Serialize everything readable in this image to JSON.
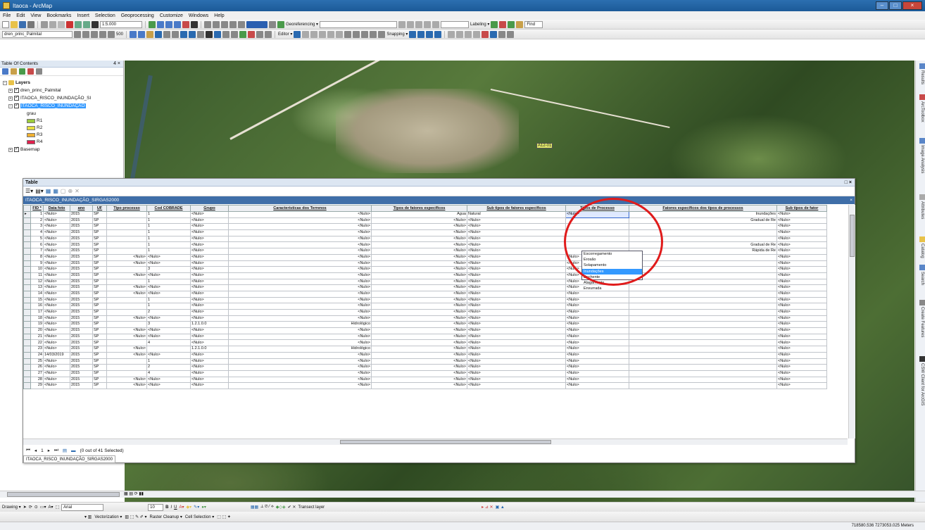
{
  "window": {
    "title": "Itaoca - ArcMap"
  },
  "menu": [
    "File",
    "Edit",
    "View",
    "Bookmarks",
    "Insert",
    "Selection",
    "Geoprocessing",
    "Customize",
    "Windows",
    "Help"
  ],
  "toolbar1": {
    "scale": "1:5.000",
    "georef_label": "Georeferencing ▾",
    "labeling_label": "Labeling ▾",
    "find_label": "Find"
  },
  "toolbar2": {
    "layer_combo": "dren_princ_Palmital",
    "value_500": "500",
    "editor_label": "Editor ▾",
    "snapping_label": "Snapping ▾"
  },
  "toc": {
    "header": "Table Of Contents",
    "pin": "4 ×",
    "layers_label": "Layers",
    "layer1": "dren_princ_Palmital",
    "layer2": "ITAOCA_RISCO_INUNDAÇÃO_SI",
    "layer3": "ITAOCA_RISCO_INUNDAÇÃO",
    "field": "grau",
    "classes": [
      {
        "label": "R1",
        "color": "#9ccc3c"
      },
      {
        "label": "R2",
        "color": "#e8e040"
      },
      {
        "label": "R3",
        "color": "#f0b030"
      },
      {
        "label": "R4",
        "color": "#e0204c"
      }
    ],
    "basemap": "Basemap"
  },
  "map": {
    "label": "A12-01"
  },
  "table_window": {
    "title": "Table",
    "close": "□ ×",
    "tab_name": "ITAOCA_RISCO_INUNDAÇÃO_SIRGAS2000",
    "tab_close": "×",
    "columns": [
      "FID *",
      "Data foto",
      "ano",
      "UF",
      "Tipo processo",
      "Cod COBRADE",
      "Grupo",
      "Características dos Terrenos",
      "Tipos de fatores específicos",
      "Sub tipos de fatores específicos",
      "Tipos de Processo",
      "Fatores específicos dos tipos de processos",
      "Sub tipos de fator"
    ],
    "status_nav": "1",
    "status_text": "(0 out of 41 Selected)",
    "bottom_tab": "ITAOCA_RISCO_INUNDAÇÃO_SIRGAS2000"
  },
  "rows": [
    [
      "1",
      "<Nulo>",
      "2015",
      "SP",
      "",
      "1",
      "<Nulo>",
      "<Nulo>",
      "Água",
      "Natural",
      "<Nulo>",
      "Inundações",
      "<Nulo>",
      ""
    ],
    [
      "2",
      "<Nulo>",
      "2015",
      "SP",
      "",
      "1",
      "<Nulo>",
      "<Nulo>",
      "<Nulo>",
      "",
      "<Nulo>",
      "",
      "",
      "Gradual de Re",
      "<Nulo>"
    ],
    [
      "3",
      "<Nulo>",
      "2015",
      "SP",
      "",
      "1",
      "<Nulo>",
      "<Nulo>",
      "<Nulo>",
      "",
      "<Nulo>",
      "",
      "<Nulo>",
      "",
      "<Nulo>"
    ],
    [
      "4",
      "<Nulo>",
      "2015",
      "SP",
      "",
      "1",
      "<Nulo>",
      "<Nulo>",
      "<Nulo>",
      "",
      "<Nulo>",
      "",
      "<Nulo>",
      "",
      "<Nulo>"
    ],
    [
      "5",
      "<Nulo>",
      "2015",
      "SP",
      "",
      "1",
      "<Nulo>",
      "<Nulo>",
      "<Nulo>",
      "",
      "<Nulo>",
      "",
      "<Nulo>",
      "",
      "<Nulo>"
    ],
    [
      "6",
      "<Nulo>",
      "2015",
      "SP",
      "",
      "1",
      "<Nulo>",
      "<Nulo>",
      "<Nulo>",
      "",
      "<Nulo>",
      "",
      "",
      "Gradual de Re",
      "<Nulo>"
    ],
    [
      "7",
      "<Nulo>",
      "2015",
      "SP",
      "",
      "1",
      "<Nulo>",
      "<Nulo>",
      "<Nulo>",
      "",
      "<Nulo>",
      "",
      "",
      "Rápida de Re",
      "<Nulo>"
    ],
    [
      "8",
      "<Nulo>",
      "2015",
      "SP",
      "<Nulo>",
      "<Nulo>",
      "<Nulo>",
      "<Nulo>",
      "<Nulo>",
      "",
      "<Nulo>",
      "<Nulo>",
      "<Nulo>",
      "",
      "<Nulo>"
    ],
    [
      "9",
      "<Nulo>",
      "2015",
      "SP",
      "<Nulo>",
      "<Nulo>",
      "<Nulo>",
      "<Nulo>",
      "<Nulo>",
      "",
      "<Nulo>",
      "<Nulo>",
      "<Nulo>",
      "",
      "<Nulo>"
    ],
    [
      "10",
      "<Nulo>",
      "2015",
      "SP",
      "",
      "3",
      "<Nulo>",
      "<Nulo>",
      "<Nulo>",
      "",
      "<Nulo>",
      "<Nulo>",
      "<Nulo>",
      "",
      "<Nulo>"
    ],
    [
      "11",
      "<Nulo>",
      "2015",
      "SP",
      "<Nulo>",
      "<Nulo>",
      "<Nulo>",
      "<Nulo>",
      "<Nulo>",
      "",
      "<Nulo>",
      "<Nulo>",
      "<Nulo>",
      "",
      "<Nulo>"
    ],
    [
      "12",
      "<Nulo>",
      "2015",
      "SP",
      "",
      "1",
      "<Nulo>",
      "<Nulo>",
      "<Nulo>",
      "",
      "<Nulo>",
      "<Nulo>",
      "<Nulo>",
      "",
      "<Nulo>"
    ],
    [
      "13",
      "<Nulo>",
      "2015",
      "SP",
      "<Nulo>",
      "<Nulo>",
      "<Nulo>",
      "<Nulo>",
      "<Nulo>",
      "",
      "<Nulo>",
      "<Nulo>",
      "<Nulo>",
      "",
      "<Nulo>"
    ],
    [
      "14",
      "<Nulo>",
      "2015",
      "SP",
      "<Nulo>",
      "<Nulo>",
      "<Nulo>",
      "<Nulo>",
      "<Nulo>",
      "",
      "<Nulo>",
      "<Nulo>",
      "<Nulo>",
      "",
      "<Nulo>"
    ],
    [
      "15",
      "<Nulo>",
      "2015",
      "SP",
      "",
      "1",
      "<Nulo>",
      "<Nulo>",
      "<Nulo>",
      "",
      "<Nulo>",
      "<Nulo>",
      "<Nulo>",
      "",
      "<Nulo>"
    ],
    [
      "16",
      "<Nulo>",
      "2015",
      "SP",
      "",
      "1",
      "<Nulo>",
      "<Nulo>",
      "<Nulo>",
      "",
      "<Nulo>",
      "<Nulo>",
      "<Nulo>",
      "",
      "<Nulo>"
    ],
    [
      "17",
      "<Nulo>",
      "2015",
      "SP",
      "",
      "2",
      "<Nulo>",
      "<Nulo>",
      "<Nulo>",
      "",
      "<Nulo>",
      "<Nulo>",
      "<Nulo>",
      "",
      "<Nulo>"
    ],
    [
      "18",
      "<Nulo>",
      "2015",
      "SP",
      "<Nulo>",
      "<Nulo>",
      "<Nulo>",
      "<Nulo>",
      "<Nulo>",
      "",
      "<Nulo>",
      "<Nulo>",
      "<Nulo>",
      "",
      "<Nulo>"
    ],
    [
      "19",
      "<Nulo>",
      "2015",
      "SP",
      "",
      "3",
      "1.2.1.0.0",
      "Hidrológico",
      "<Nulo>",
      "",
      "<Nulo>",
      "<Nulo>",
      "<Nulo>",
      "",
      "<Nulo>"
    ],
    [
      "20",
      "<Nulo>",
      "2015",
      "SP",
      "<Nulo>",
      "<Nulo>",
      "<Nulo>",
      "<Nulo>",
      "<Nulo>",
      "",
      "<Nulo>",
      "<Nulo>",
      "<Nulo>",
      "",
      "<Nulo>"
    ],
    [
      "21",
      "<Nulo>",
      "2015",
      "SP",
      "<Nulo>",
      "<Nulo>",
      "<Nulo>",
      "<Nulo>",
      "<Nulo>",
      "",
      "<Nulo>",
      "<Nulo>",
      "<Nulo>",
      "",
      "<Nulo>"
    ],
    [
      "22",
      "<Nulo>",
      "2015",
      "SP",
      "",
      "4",
      "<Nulo>",
      "<Nulo>",
      "<Nulo>",
      "",
      "<Nulo>",
      "<Nulo>",
      "<Nulo>",
      "",
      "<Nulo>"
    ],
    [
      "23",
      "<Nulo>",
      "2015",
      "SP",
      "<Nulo>",
      "",
      "1.2.1.0.0",
      "Hidrológico",
      "<Nulo>",
      "",
      "<Nulo>",
      "<Nulo>",
      "<Nulo>",
      "",
      "<Nulo>"
    ],
    [
      "24",
      "14/03/2019",
      "2015",
      "SP",
      "<Nulo>",
      "<Nulo>",
      "<Nulo>",
      "<Nulo>",
      "<Nulo>",
      "",
      "<Nulo>",
      "<Nulo>",
      "<Nulo>",
      "",
      "<Nulo>"
    ],
    [
      "25",
      "<Nulo>",
      "2015",
      "SP",
      "",
      "1",
      "<Nulo>",
      "<Nulo>",
      "<Nulo>",
      "",
      "<Nulo>",
      "<Nulo>",
      "<Nulo>",
      "",
      "<Nulo>"
    ],
    [
      "26",
      "<Nulo>",
      "2015",
      "SP",
      "",
      "2",
      "<Nulo>",
      "<Nulo>",
      "<Nulo>",
      "",
      "<Nulo>",
      "<Nulo>",
      "<Nulo>",
      "",
      "<Nulo>"
    ],
    [
      "27",
      "<Nulo>",
      "2015",
      "SP",
      "",
      "4",
      "<Nulo>",
      "<Nulo>",
      "<Nulo>",
      "",
      "<Nulo>",
      "<Nulo>",
      "<Nulo>",
      "",
      "<Nulo>"
    ],
    [
      "28",
      "<Nulo>",
      "2015",
      "SP",
      "<Nulo>",
      "<Nulo>",
      "<Nulo>",
      "<Nulo>",
      "<Nulo>",
      "",
      "<Nulo>",
      "<Nulo>",
      "<Nulo>",
      "",
      "<Nulo>"
    ],
    [
      "29",
      "<Nulo>",
      "2015",
      "SP",
      "<Nulo>",
      "<Nulo>",
      "<Nulo>",
      "<Nulo>",
      "<Nulo>",
      "",
      "<Nulo>",
      "<Nulo>",
      "<Nulo>",
      "",
      "<Nulo>"
    ]
  ],
  "dropdown": {
    "options": [
      "Escorregamento",
      "Erosão",
      "Solapamento",
      "Inundações",
      "Enchente",
      "Alagamento",
      "Enxurrada"
    ],
    "highlighted": "Inundações"
  },
  "dock_tabs": [
    "Results",
    "ArcToolbox",
    "Image Analysis",
    "Attributes",
    "Catalog",
    "Search",
    "Create Features",
    "CSW Client for ArcGIS"
  ],
  "drawing": {
    "label": "Drawing ▾",
    "font": "Arial",
    "size": "10",
    "transect": "Transect layer"
  },
  "bottom2": {
    "vectorization": "Vectorization ▾",
    "raster_cleanup": "Raster Cleanup ▾",
    "cell_selection": "Cell Selection ▾"
  },
  "status": {
    "coords": "718580.536 7273053.025 Meters"
  },
  "colors": {
    "accent": "#3f6ea8",
    "highlight": "#3399ff",
    "circle": "#e01b1b"
  }
}
